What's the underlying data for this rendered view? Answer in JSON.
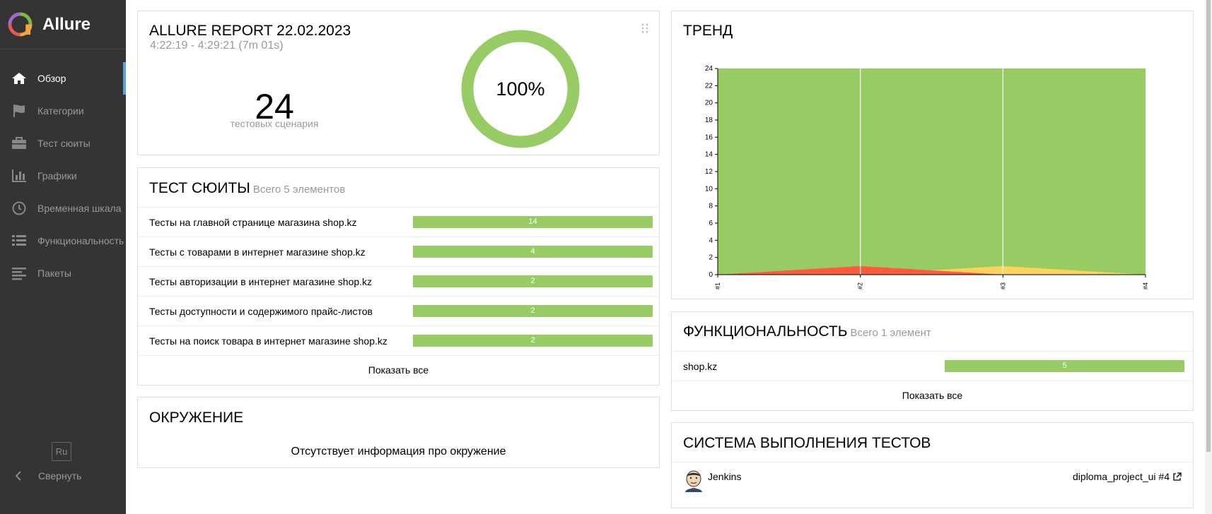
{
  "sidebar": {
    "brand": "Allure",
    "items": [
      {
        "label": "Обзор",
        "icon": "home-icon",
        "active": true
      },
      {
        "label": "Категории",
        "icon": "flag-icon"
      },
      {
        "label": "Тест сюиты",
        "icon": "briefcase-icon"
      },
      {
        "label": "Графики",
        "icon": "bar-chart-icon"
      },
      {
        "label": "Временная шкала",
        "icon": "clock-icon"
      },
      {
        "label": "Функциональность",
        "icon": "list-icon"
      },
      {
        "label": "Пакеты",
        "icon": "align-left-icon"
      }
    ],
    "lang": "Ru",
    "collapse": "Свернуть"
  },
  "summary": {
    "title": "ALLURE REPORT 22.02.2023",
    "time": "4:22:19 - 4:29:21 (7m 01s)",
    "count": "24",
    "count_label": "тестовых сценария",
    "percent": "100%",
    "percent_value": 100
  },
  "suites": {
    "title": "ТЕСТ СЮИТЫ",
    "subtitle": "Всего 5 элементов",
    "rows": [
      {
        "name": "Тесты на главной странице магазина shop.kz",
        "value": "14"
      },
      {
        "name": "Тесты с товарами в интернет магазине shop.kz",
        "value": "4"
      },
      {
        "name": "Тесты авторизации в интернет магазине shop.kz",
        "value": "2"
      },
      {
        "name": "Тесты доступности и содержимого прайс-листов",
        "value": "2"
      },
      {
        "name": "Тесты на поиск товара в интернет магазине shop.kz",
        "value": "2"
      }
    ],
    "show_all": "Показать все"
  },
  "environment": {
    "title": "ОКРУЖЕНИЕ",
    "empty": "Отсутствует информация про окружение"
  },
  "trend": {
    "title": "ТРЕНД"
  },
  "chart_data": {
    "type": "area",
    "title": "ТРЕНД",
    "x": [
      "#1",
      "#2",
      "#3",
      "#4"
    ],
    "yticks": [
      0,
      2,
      4,
      6,
      8,
      10,
      12,
      14,
      16,
      18,
      20,
      22,
      24
    ],
    "ylim": [
      0,
      24
    ],
    "series": [
      {
        "color": "#97cc64",
        "values": [
          24,
          24,
          24,
          24
        ]
      },
      {
        "color": "#fed35d",
        "values": [
          0,
          0,
          1,
          0
        ]
      },
      {
        "color": "#fd5a3e",
        "values": [
          0,
          1,
          0,
          0
        ]
      }
    ]
  },
  "features": {
    "title": "ФУНКЦИОНАЛЬНОСТЬ",
    "subtitle": "Всего 1 элемент",
    "rows": [
      {
        "name": "shop.kz",
        "value": "5"
      }
    ],
    "show_all": "Показать все"
  },
  "executors": {
    "title": "СИСТЕМА ВЫПОЛНЕНИЯ ТЕСТОВ",
    "name": "Jenkins",
    "build": "diploma_project_ui #4"
  },
  "colors": {
    "passed": "#97cc64",
    "broken": "#fed35d",
    "failed": "#fd5a3e",
    "sidebar": "#343434",
    "accent": "#5da1df"
  }
}
